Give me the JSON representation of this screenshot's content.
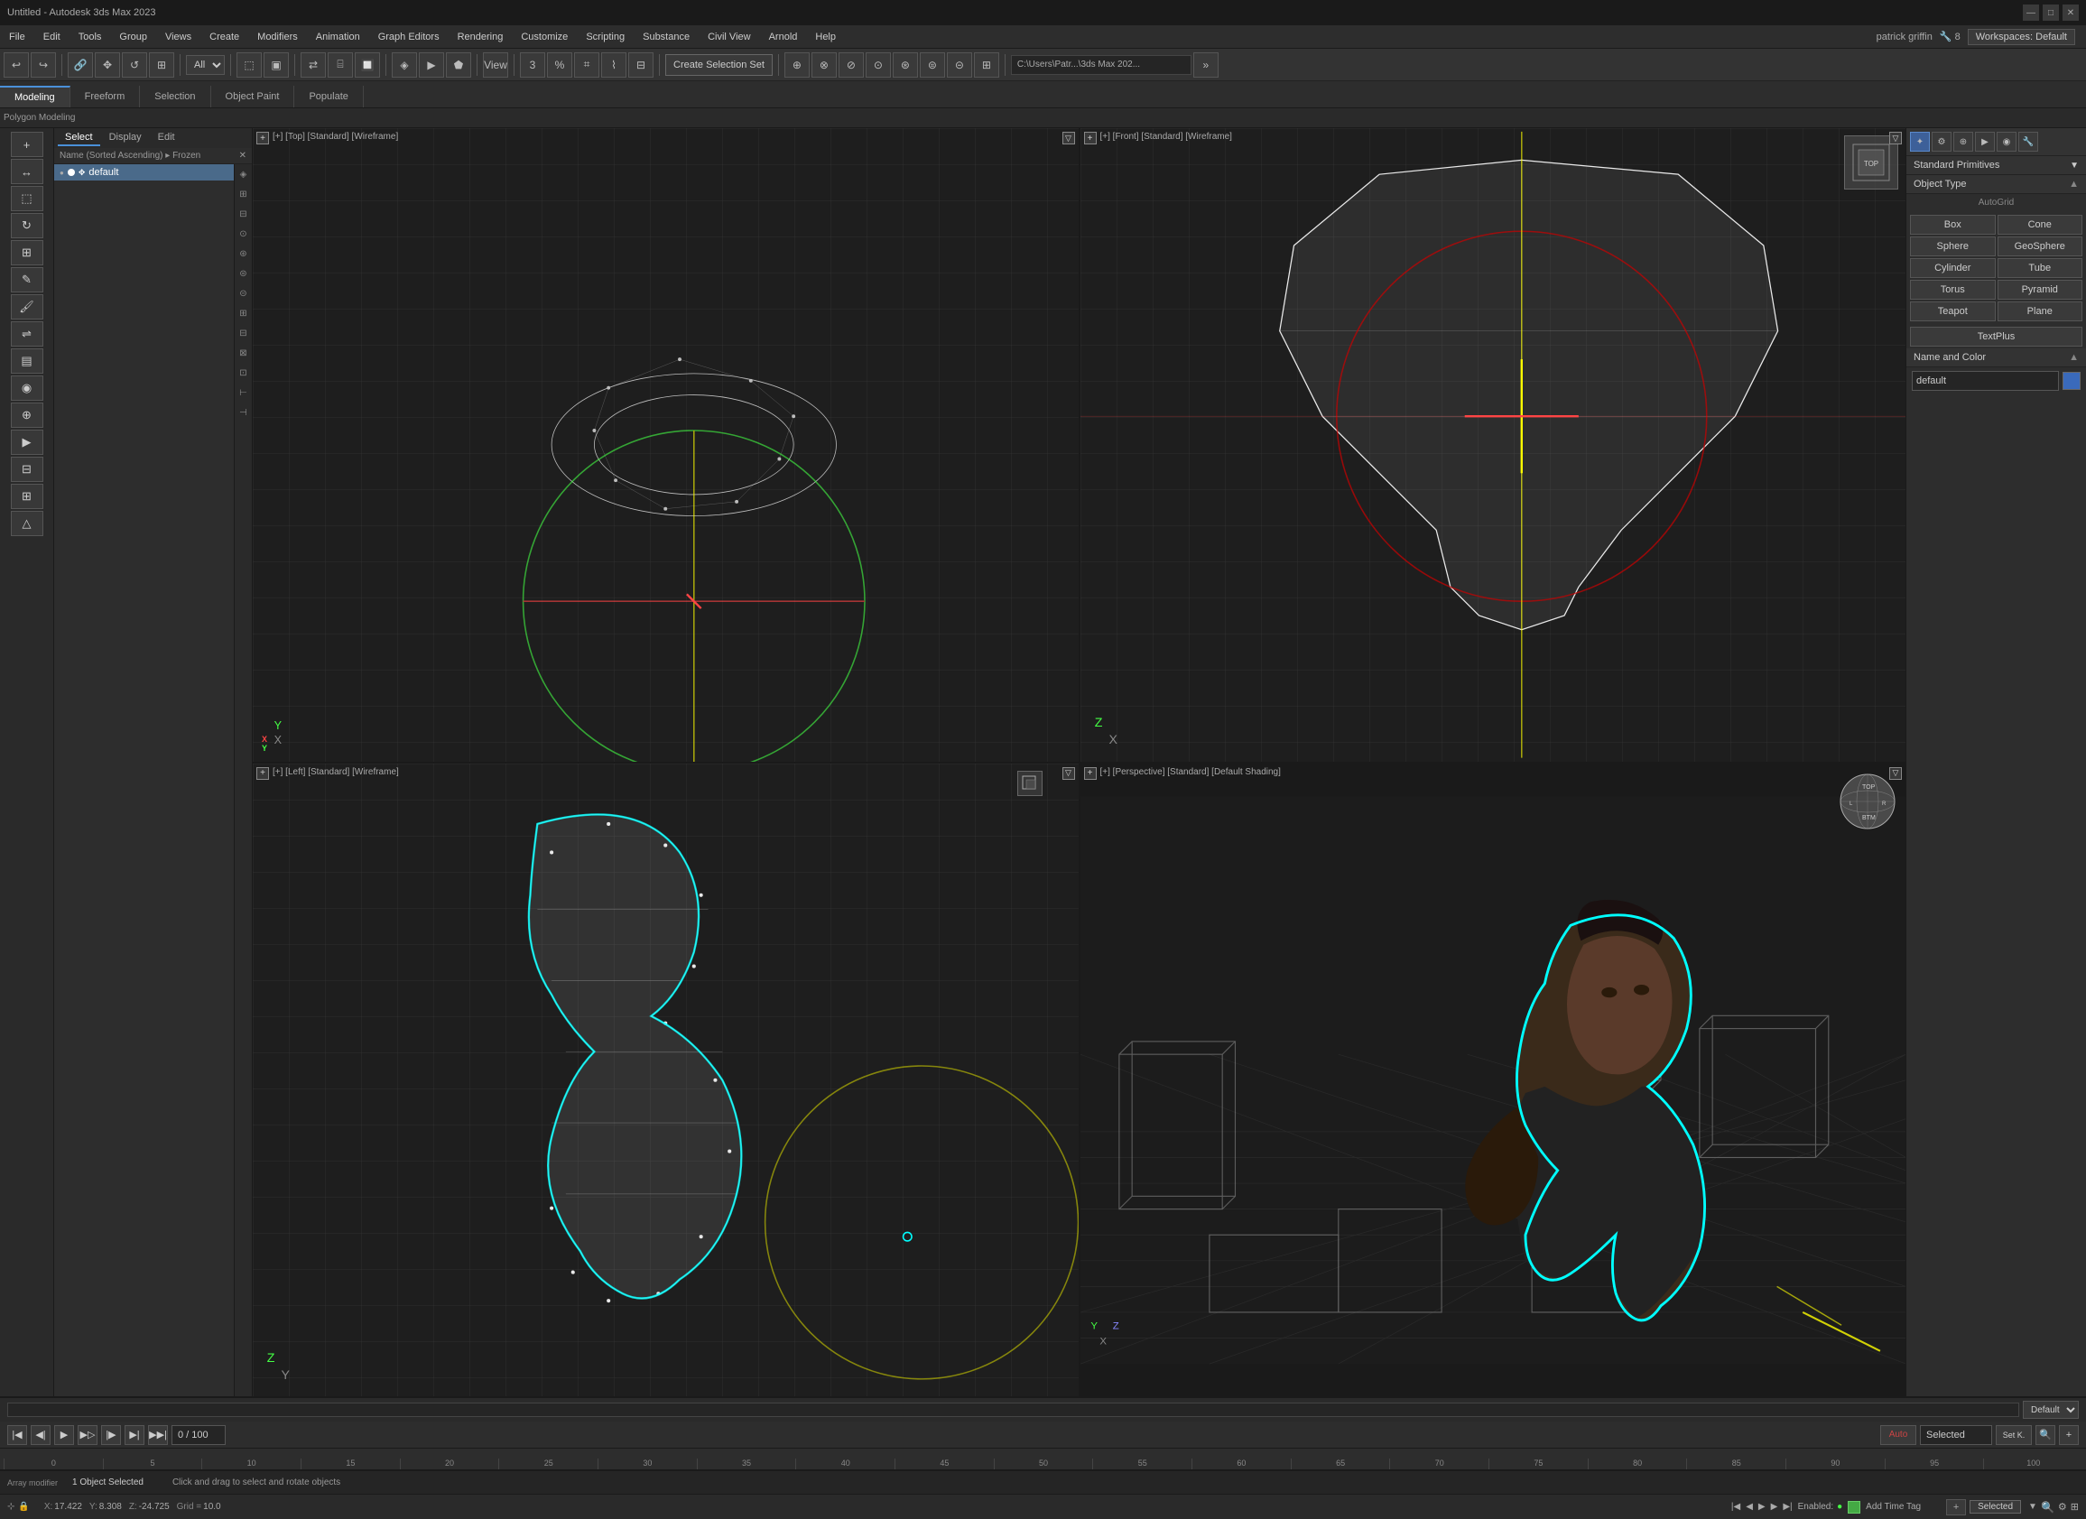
{
  "app": {
    "title": "Untitled - Autodesk 3ds Max 2023",
    "window_controls": [
      "—",
      "□",
      "✕"
    ]
  },
  "menu": {
    "items": [
      "File",
      "Edit",
      "Tools",
      "Group",
      "Views",
      "Create",
      "Modifiers",
      "Animation",
      "Graph Editors",
      "Rendering",
      "Customize",
      "Scripting",
      "Substance",
      "Civil View",
      "Arnold",
      "Help"
    ],
    "workspace_label": "Workspaces: Default",
    "user": "patrick griffin"
  },
  "toolbar": {
    "filter_label": "All",
    "create_selection_label": "Create Selection Set",
    "path": "C:\\Users\\Patr...\\3ds Max 202..."
  },
  "modeling_tabs": {
    "tabs": [
      "Modeling",
      "Freeform",
      "Selection",
      "Object Paint",
      "Populate"
    ],
    "active": "Modeling",
    "sub_label": "Polygon Modeling"
  },
  "scene_explorer": {
    "sort_label": "Name (Sorted Ascending) ▸ Frozen",
    "tabs": [
      "Select",
      "Display",
      "Edit"
    ],
    "active_tab": "Select",
    "items": [
      {
        "name": "default",
        "icon": "●"
      }
    ]
  },
  "viewports": {
    "top": {
      "label": "[+] [Top] [Standard] [Wireframe]",
      "plus": "+",
      "filter": "▽"
    },
    "front": {
      "label": "[+] [Front] [Standard] [Wireframe]",
      "plus": "+",
      "filter": "▽"
    },
    "left": {
      "label": "[+] [Left] [Standard] [Wireframe]",
      "plus": "+",
      "filter": "▽"
    },
    "perspective": {
      "label": "[+] [Perspective] [Standard] [Default Shading]",
      "plus": "+",
      "filter": "▽"
    }
  },
  "right_panel": {
    "std_primitives_label": "Standard Primitives",
    "object_type_label": "Object Type",
    "auto_grid_label": "AutoGrid",
    "primitives": [
      "Box",
      "Cone",
      "Sphere",
      "GeoSphere",
      "Cylinder",
      "Tube",
      "Torus",
      "Pyramid",
      "Teapot",
      "Plane"
    ],
    "textplus_label": "TextPlus",
    "name_color_label": "Name and Color",
    "name_value": "default",
    "color_hex": "#3a6abb"
  },
  "timeline": {
    "frame_value": "0 / 100",
    "layer_label": "Default",
    "ruler_ticks": [
      0,
      5,
      10,
      15,
      20,
      25,
      30,
      35,
      40,
      45,
      50,
      55,
      60,
      65,
      70,
      75,
      80,
      85,
      90,
      95,
      100
    ],
    "auto_label": "Auto",
    "selected_label": "Selected",
    "set_k_label": "Set K."
  },
  "status": {
    "object_selected": "1 Object Selected",
    "prompt": "Click and drag to select and rotate objects",
    "x": "17.422",
    "y": "8.308",
    "z": "-24.725",
    "grid": "10.0",
    "enabled_label": "Enabled:",
    "add_time_tag_label": "Add Time Tag",
    "selected_label": "Selected",
    "coord_labels": [
      "X:",
      "Y:",
      "Z:",
      "Grid ="
    ]
  }
}
